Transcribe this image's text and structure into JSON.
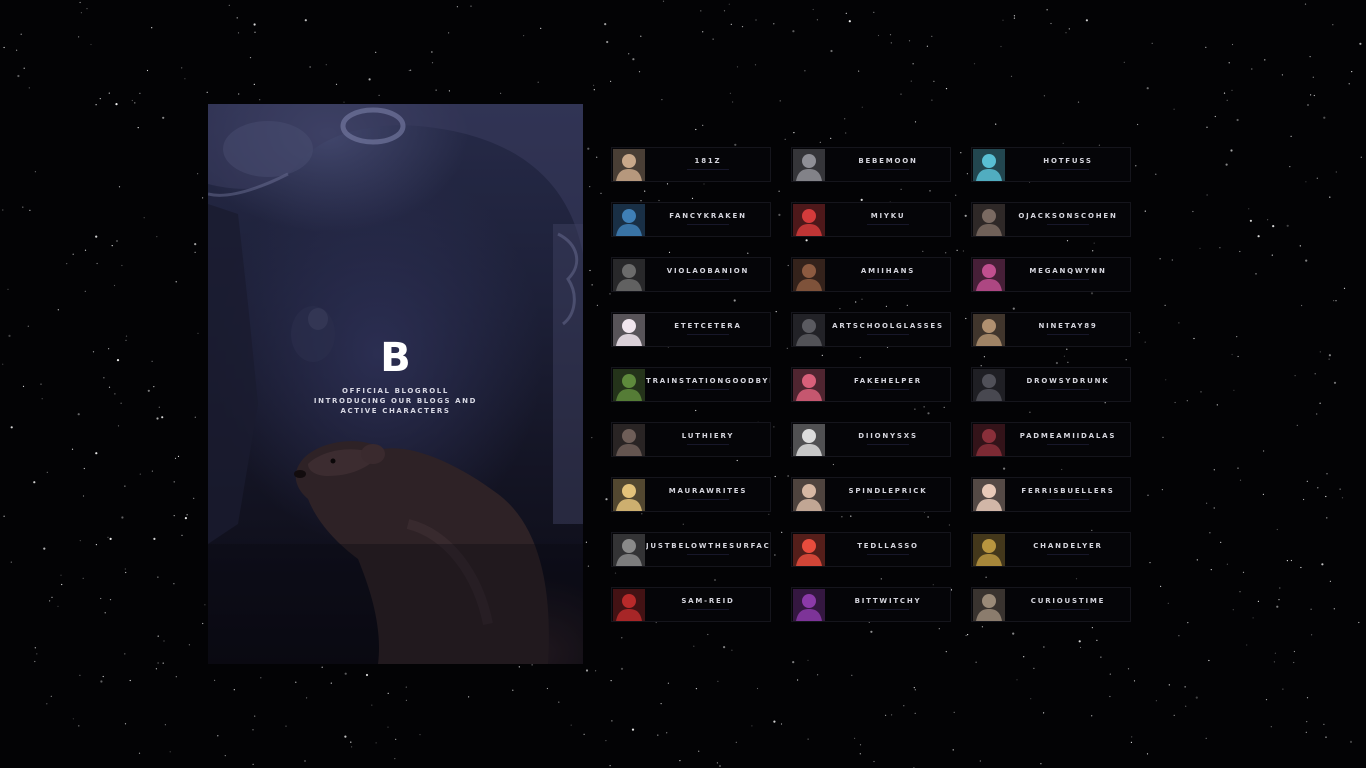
{
  "hero": {
    "logo": "B",
    "lines": [
      "OFFICIAL BLOGROLL",
      "INTRODUCING OUR BLOGS AND",
      "ACTIVE CHARACTERS"
    ]
  },
  "blogs": [
    {
      "name": "181Z",
      "avatar": "teddy-bear",
      "color": "#c9a88a"
    },
    {
      "name": "BEBEMOON",
      "avatar": "figurine",
      "color": "#8f8f96"
    },
    {
      "name": "HOTFUSS",
      "avatar": "person-blue",
      "color": "#59bfd3"
    },
    {
      "name": "FANCYKRAKEN",
      "avatar": "man-hat",
      "color": "#3f7fb6"
    },
    {
      "name": "MIYKU",
      "avatar": "painted-face",
      "color": "#d33b3b"
    },
    {
      "name": "OJACKSONSCOHEN",
      "avatar": "man-portrait",
      "color": "#7a6a62"
    },
    {
      "name": "VIOLAOBANION",
      "avatar": "bw-portrait",
      "color": "#6b6b6b"
    },
    {
      "name": "AMIIHANS",
      "avatar": "man-warm",
      "color": "#8c5a40"
    },
    {
      "name": "MEGANQWYNN",
      "avatar": "comic",
      "color": "#c04f8f"
    },
    {
      "name": "ETETCETERA",
      "avatar": "flowers",
      "color": "#f1e6ee"
    },
    {
      "name": "ARTSCHOOLGLASSES",
      "avatar": "crowd",
      "color": "#5a5a60"
    },
    {
      "name": "NINETAY89",
      "avatar": "blonde-girl",
      "color": "#b09070"
    },
    {
      "name": "TRAINSTATIONGOODBYE",
      "avatar": "green-girl",
      "color": "#5e8a3c"
    },
    {
      "name": "FAKEHELPER",
      "avatar": "pink-circle",
      "color": "#d9607a"
    },
    {
      "name": "DROWSYDRUNK",
      "avatar": "bw-woman",
      "color": "#505058"
    },
    {
      "name": "LUTHIERY",
      "avatar": "reclining",
      "color": "#6e5e58"
    },
    {
      "name": "DIIONYSXS",
      "avatar": "sketch",
      "color": "#dcdcdc"
    },
    {
      "name": "PADMEAMIIDALAS",
      "avatar": "queen",
      "color": "#8a2f3a"
    },
    {
      "name": "MAURAWRITES",
      "avatar": "blonde-woman",
      "color": "#e3c27a"
    },
    {
      "name": "SPINDLEPRICK",
      "avatar": "pale-face",
      "color": "#d6b7a3"
    },
    {
      "name": "FERRISBUELLERS",
      "avatar": "heart-locket",
      "color": "#e8c9b8"
    },
    {
      "name": "JUSTBELOWTHESURFACE",
      "avatar": "bw-man",
      "color": "#8a8a8a"
    },
    {
      "name": "TEDLLASSO",
      "avatar": "rainbow",
      "color": "#e84c3d"
    },
    {
      "name": "CHANDELYER",
      "avatar": "gold-pendant",
      "color": "#b8953f"
    },
    {
      "name": "SAM-REID",
      "avatar": "woman-red",
      "color": "#b82a2a"
    },
    {
      "name": "BITTWITCHY",
      "avatar": "woman-purple",
      "color": "#8b3aa8"
    },
    {
      "name": "CURIOUSTIME",
      "avatar": "sepia-woman",
      "color": "#9a8a78"
    }
  ]
}
